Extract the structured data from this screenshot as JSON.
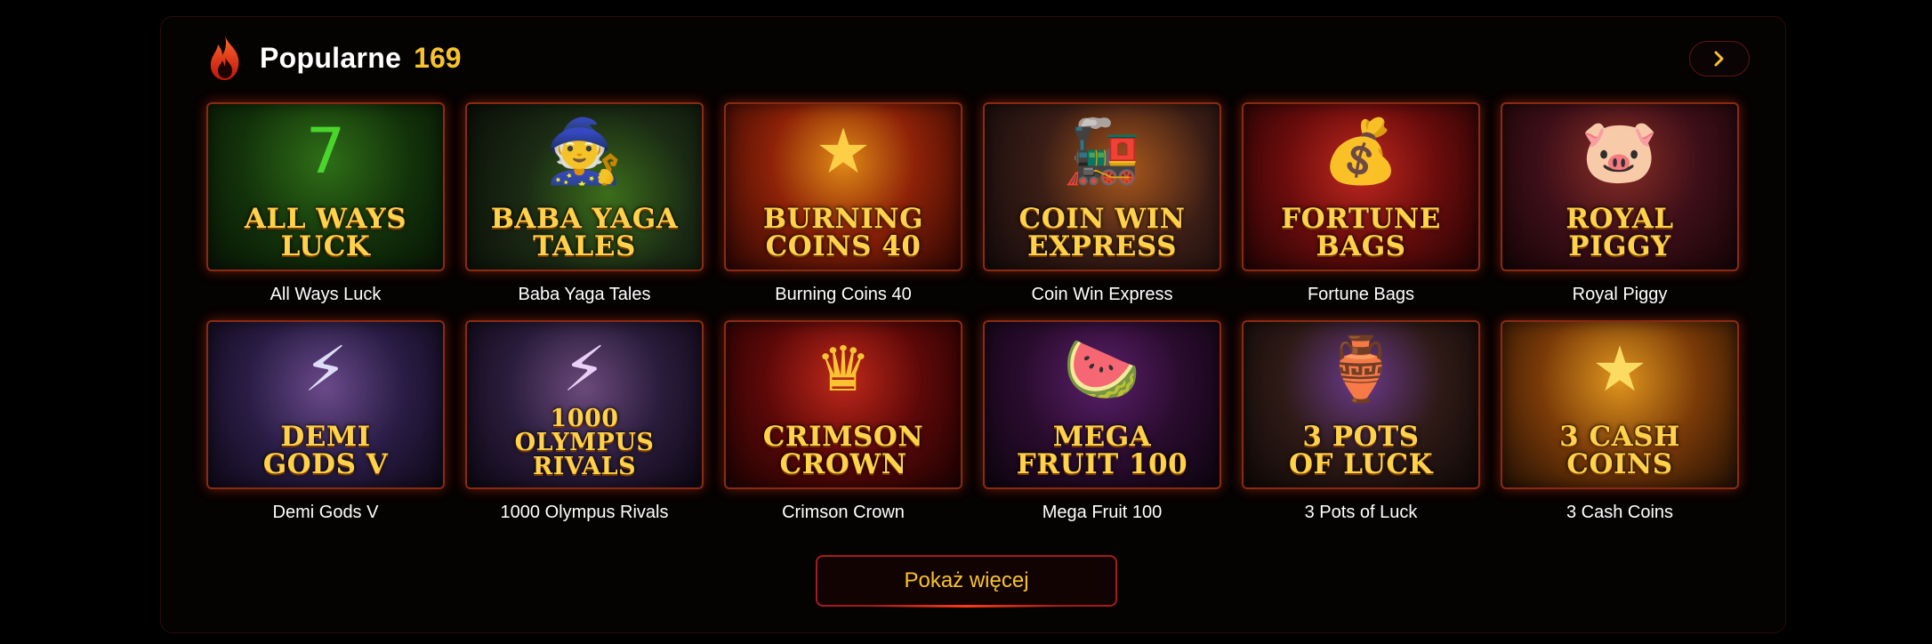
{
  "section": {
    "icon": "flame-icon",
    "title": "Popularne",
    "count": "169",
    "next_icon": "chevron-right-icon"
  },
  "colors": {
    "accent": "#f7c329",
    "border": "#a51b1b",
    "background": "#000000"
  },
  "games": [
    {
      "label": "All Ways Luck",
      "art": [
        "ALL WAYS",
        "LUCK"
      ],
      "icon": "seven-icon",
      "glyph": "7",
      "bg": "radial-gradient(circle at 50% 35%, #2f6e17 0%, #12310a 55%, #081405 100%)",
      "glyph_color": "#4cdc2f"
    },
    {
      "label": "Baba Yaga Tales",
      "art": [
        "BABA YAGA",
        "TALES"
      ],
      "icon": "witch-cauldron-icon",
      "glyph": "🧙",
      "bg": "radial-gradient(circle at 60% 55%, #3c6d1b 0%, #1a2a14 50%, #0b0f08 100%)",
      "glyph_color": "#7fdc3a"
    },
    {
      "label": "Burning Coins 40",
      "art": [
        "BURNING",
        "COINS 40"
      ],
      "icon": "coin-icon",
      "glyph": "★",
      "bg": "radial-gradient(circle at 50% 35%, #e08a16 0%, #8e2208 45%, #2a0503 100%)",
      "glyph_color": "#ffd44a"
    },
    {
      "label": "Coin Win Express",
      "art": [
        "COIN WIN",
        "EXPRESS"
      ],
      "icon": "train-icon",
      "glyph": "🚂",
      "bg": "radial-gradient(circle at 60% 40%, #a8571c 0%, #3a1d16 50%, #120a0a 100%)",
      "glyph_color": "#ffb54a"
    },
    {
      "label": "Fortune Bags",
      "art": [
        "FORTUNE",
        "BAGS"
      ],
      "icon": "money-bag-icon",
      "glyph": "💰",
      "bg": "radial-gradient(circle at 50% 40%, #c0281e 0%, #6a0c0c 50%, #200303 100%)",
      "glyph_color": "#ffd44a"
    },
    {
      "label": "Royal Piggy",
      "art": [
        "ROYAL",
        "PIGGY"
      ],
      "icon": "pig-icon",
      "glyph": "🐷",
      "bg": "radial-gradient(circle at 50% 35%, #8a2e26 0%, #3e0f18 50%, #150407 100%)",
      "glyph_color": "#ffb0a0"
    },
    {
      "label": "Demi Gods V",
      "art": [
        "DEMI",
        "GODS V"
      ],
      "icon": "lightning-icon",
      "glyph": "⚡",
      "bg": "radial-gradient(circle at 50% 40%, #6a4a8a 0%, #2a1d46 50%, #0d0816 100%)",
      "glyph_color": "#e6e6ff"
    },
    {
      "label": "1000 Olympus Rivals",
      "art": [
        "1000",
        "OLYMPUS",
        "RIVALS"
      ],
      "icon": "lightning-icon",
      "glyph": "⚡",
      "bg": "radial-gradient(circle at 50% 40%, #6b4a7a 0%, #2a1c3c 50%, #0c0712 100%)",
      "glyph_color": "#f2d8ff"
    },
    {
      "label": "Crimson Crown",
      "art": [
        "CRIMSON",
        "CROWN"
      ],
      "icon": "crown-icon",
      "glyph": "♛",
      "bg": "radial-gradient(circle at 50% 35%, #c0281a 0%, #5c0808 50%, #1c0202 100%)",
      "glyph_color": "#ffcc33"
    },
    {
      "label": "Mega Fruit 100",
      "art": [
        "MEGA",
        "FRUIT 100"
      ],
      "icon": "fruit-icon",
      "glyph": "🍉",
      "bg": "radial-gradient(circle at 50% 35%, #5a1f6a 0%, #2a0c2e 50%, #0d040f 100%)",
      "glyph_color": "#ff4a4a"
    },
    {
      "label": "3 Pots of Luck",
      "art": [
        "3 POTS",
        "OF LUCK"
      ],
      "icon": "pot-icon",
      "glyph": "🏺",
      "bg": "radial-gradient(circle at 50% 35%, #6a3a8a 0%, #2e1a16 50%, #0e0806 100%)",
      "glyph_color": "#ffd44a"
    },
    {
      "label": "3 Cash Coins",
      "art": [
        "3 CASH",
        "COINS"
      ],
      "icon": "coin-icon",
      "glyph": "★",
      "bg": "radial-gradient(circle at 50% 35%, #e0961e 0%, #7a3a08 50%, #221004 100%)",
      "glyph_color": "#ffe066"
    }
  ],
  "more_button": {
    "label": "Pokaż więcej"
  }
}
